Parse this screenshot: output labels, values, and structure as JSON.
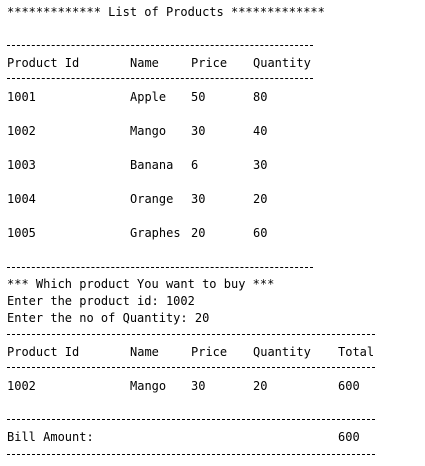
{
  "header": {
    "title": "************* List of Products *************"
  },
  "list_table": {
    "columns": [
      "Product Id",
      "Name",
      "Price",
      "Quantity"
    ],
    "rows": [
      [
        "1001",
        "Apple",
        "50",
        "80"
      ],
      [
        "1002",
        "Mango",
        "30",
        "40"
      ],
      [
        "1003",
        "Banana",
        "6",
        "30"
      ],
      [
        "1004",
        "Orange",
        "30",
        "20"
      ],
      [
        "1005",
        "Graphes",
        "20",
        "60"
      ]
    ]
  },
  "prompt": {
    "question": "*** Which product You want to buy ***",
    "product_id_line": "Enter the product id: 1002",
    "quantity_line": "Enter the no of Quantity: 20"
  },
  "bill_table": {
    "columns": [
      "Product Id",
      "Name",
      "Price",
      "Quantity",
      "Total"
    ],
    "row": [
      "1002",
      "Mango",
      "30",
      "20",
      "600"
    ]
  },
  "bill": {
    "label": "Bill Amount:",
    "amount": "600"
  }
}
